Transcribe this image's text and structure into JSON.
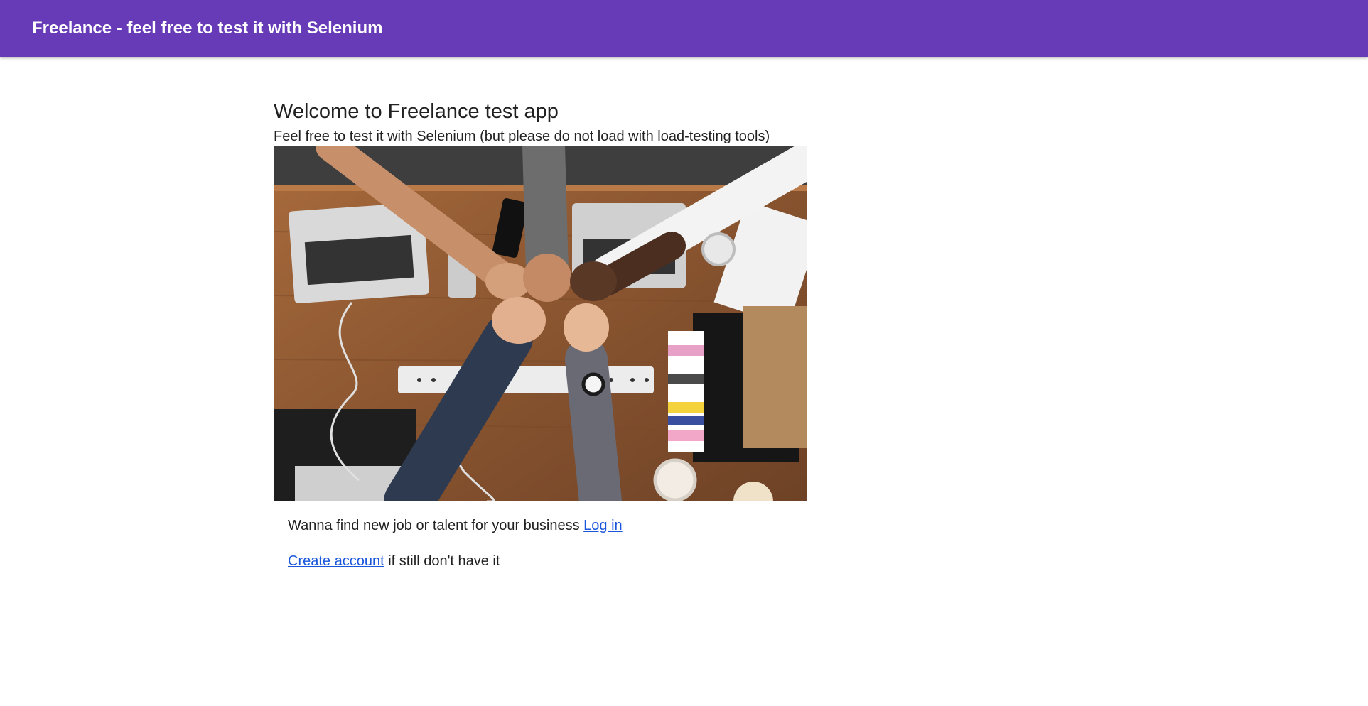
{
  "appbar": {
    "title": "Freelance - feel free to test it with Selenium",
    "color": "#673ab7"
  },
  "main": {
    "heading": "Welcome to Freelance test app",
    "subtitle": "Feel free to test it with Selenium (but please do not load with load-testing tools)",
    "hero_image": "team fist bump over wooden desk with laptops",
    "login_line": {
      "text": "Wanna find new job or talent for your business ",
      "link": "Log in"
    },
    "register_line": {
      "link": "Create account",
      "text": " if still don't have it"
    },
    "link_color": "#1a56db"
  }
}
